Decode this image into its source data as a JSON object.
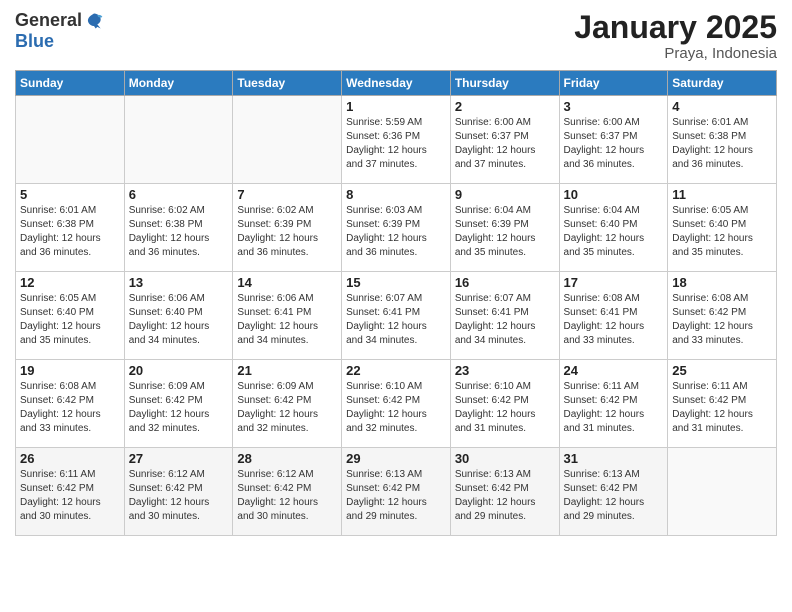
{
  "header": {
    "logo_general": "General",
    "logo_blue": "Blue",
    "month": "January 2025",
    "location": "Praya, Indonesia"
  },
  "days_of_week": [
    "Sunday",
    "Monday",
    "Tuesday",
    "Wednesday",
    "Thursday",
    "Friday",
    "Saturday"
  ],
  "weeks": [
    [
      {
        "day": "",
        "info": ""
      },
      {
        "day": "",
        "info": ""
      },
      {
        "day": "",
        "info": ""
      },
      {
        "day": "1",
        "info": "Sunrise: 5:59 AM\nSunset: 6:36 PM\nDaylight: 12 hours\nand 37 minutes."
      },
      {
        "day": "2",
        "info": "Sunrise: 6:00 AM\nSunset: 6:37 PM\nDaylight: 12 hours\nand 37 minutes."
      },
      {
        "day": "3",
        "info": "Sunrise: 6:00 AM\nSunset: 6:37 PM\nDaylight: 12 hours\nand 36 minutes."
      },
      {
        "day": "4",
        "info": "Sunrise: 6:01 AM\nSunset: 6:38 PM\nDaylight: 12 hours\nand 36 minutes."
      }
    ],
    [
      {
        "day": "5",
        "info": "Sunrise: 6:01 AM\nSunset: 6:38 PM\nDaylight: 12 hours\nand 36 minutes."
      },
      {
        "day": "6",
        "info": "Sunrise: 6:02 AM\nSunset: 6:38 PM\nDaylight: 12 hours\nand 36 minutes."
      },
      {
        "day": "7",
        "info": "Sunrise: 6:02 AM\nSunset: 6:39 PM\nDaylight: 12 hours\nand 36 minutes."
      },
      {
        "day": "8",
        "info": "Sunrise: 6:03 AM\nSunset: 6:39 PM\nDaylight: 12 hours\nand 36 minutes."
      },
      {
        "day": "9",
        "info": "Sunrise: 6:04 AM\nSunset: 6:39 PM\nDaylight: 12 hours\nand 35 minutes."
      },
      {
        "day": "10",
        "info": "Sunrise: 6:04 AM\nSunset: 6:40 PM\nDaylight: 12 hours\nand 35 minutes."
      },
      {
        "day": "11",
        "info": "Sunrise: 6:05 AM\nSunset: 6:40 PM\nDaylight: 12 hours\nand 35 minutes."
      }
    ],
    [
      {
        "day": "12",
        "info": "Sunrise: 6:05 AM\nSunset: 6:40 PM\nDaylight: 12 hours\nand 35 minutes."
      },
      {
        "day": "13",
        "info": "Sunrise: 6:06 AM\nSunset: 6:40 PM\nDaylight: 12 hours\nand 34 minutes."
      },
      {
        "day": "14",
        "info": "Sunrise: 6:06 AM\nSunset: 6:41 PM\nDaylight: 12 hours\nand 34 minutes."
      },
      {
        "day": "15",
        "info": "Sunrise: 6:07 AM\nSunset: 6:41 PM\nDaylight: 12 hours\nand 34 minutes."
      },
      {
        "day": "16",
        "info": "Sunrise: 6:07 AM\nSunset: 6:41 PM\nDaylight: 12 hours\nand 34 minutes."
      },
      {
        "day": "17",
        "info": "Sunrise: 6:08 AM\nSunset: 6:41 PM\nDaylight: 12 hours\nand 33 minutes."
      },
      {
        "day": "18",
        "info": "Sunrise: 6:08 AM\nSunset: 6:42 PM\nDaylight: 12 hours\nand 33 minutes."
      }
    ],
    [
      {
        "day": "19",
        "info": "Sunrise: 6:08 AM\nSunset: 6:42 PM\nDaylight: 12 hours\nand 33 minutes."
      },
      {
        "day": "20",
        "info": "Sunrise: 6:09 AM\nSunset: 6:42 PM\nDaylight: 12 hours\nand 32 minutes."
      },
      {
        "day": "21",
        "info": "Sunrise: 6:09 AM\nSunset: 6:42 PM\nDaylight: 12 hours\nand 32 minutes."
      },
      {
        "day": "22",
        "info": "Sunrise: 6:10 AM\nSunset: 6:42 PM\nDaylight: 12 hours\nand 32 minutes."
      },
      {
        "day": "23",
        "info": "Sunrise: 6:10 AM\nSunset: 6:42 PM\nDaylight: 12 hours\nand 31 minutes."
      },
      {
        "day": "24",
        "info": "Sunrise: 6:11 AM\nSunset: 6:42 PM\nDaylight: 12 hours\nand 31 minutes."
      },
      {
        "day": "25",
        "info": "Sunrise: 6:11 AM\nSunset: 6:42 PM\nDaylight: 12 hours\nand 31 minutes."
      }
    ],
    [
      {
        "day": "26",
        "info": "Sunrise: 6:11 AM\nSunset: 6:42 PM\nDaylight: 12 hours\nand 30 minutes."
      },
      {
        "day": "27",
        "info": "Sunrise: 6:12 AM\nSunset: 6:42 PM\nDaylight: 12 hours\nand 30 minutes."
      },
      {
        "day": "28",
        "info": "Sunrise: 6:12 AM\nSunset: 6:42 PM\nDaylight: 12 hours\nand 30 minutes."
      },
      {
        "day": "29",
        "info": "Sunrise: 6:13 AM\nSunset: 6:42 PM\nDaylight: 12 hours\nand 29 minutes."
      },
      {
        "day": "30",
        "info": "Sunrise: 6:13 AM\nSunset: 6:42 PM\nDaylight: 12 hours\nand 29 minutes."
      },
      {
        "day": "31",
        "info": "Sunrise: 6:13 AM\nSunset: 6:42 PM\nDaylight: 12 hours\nand 29 minutes."
      },
      {
        "day": "",
        "info": ""
      }
    ]
  ]
}
